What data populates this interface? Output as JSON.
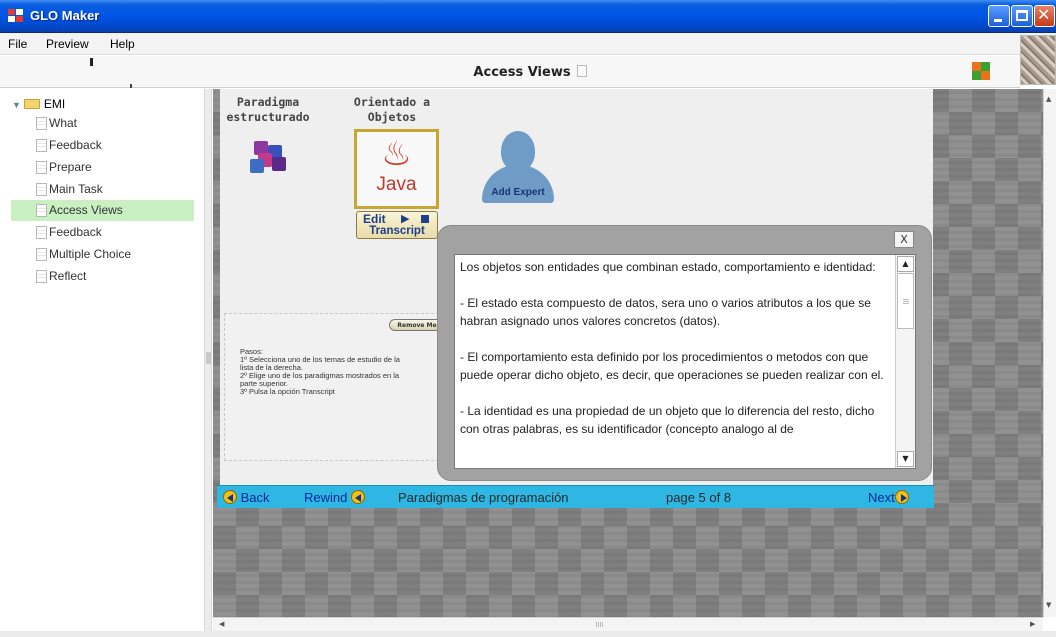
{
  "window": {
    "title": "GLO Maker"
  },
  "menu": [
    "File",
    "Preview",
    "Help"
  ],
  "page": {
    "title": "Access Views"
  },
  "tree": {
    "root": "EMI",
    "items": [
      {
        "label": "What",
        "selected": false
      },
      {
        "label": "Feedback",
        "selected": false
      },
      {
        "label": "Prepare",
        "selected": false
      },
      {
        "label": "Main Task",
        "selected": false
      },
      {
        "label": "Access Views",
        "selected": true
      },
      {
        "label": "Feedback",
        "selected": false
      },
      {
        "label": "Multiple Choice",
        "selected": false
      },
      {
        "label": "Reflect",
        "selected": false
      }
    ]
  },
  "lesson": {
    "paradigm1": [
      "Paradigma",
      "estructurado"
    ],
    "paradigm2": [
      "Orientado a",
      "Objetos"
    ],
    "java_label": "Java",
    "edit_label": "Edit",
    "transcript_label": "Transcript",
    "add_expert_label": "Add Expert",
    "remove_label": "Remove Me",
    "steps": [
      "Pasos:",
      "1º Selecciona uno de los temas de estudio de la",
      "lista de la derecha.",
      "2º Elige uno de los paradigmas mostrados en la",
      "parte superior.",
      "3º Pulsa la opción Transcript"
    ]
  },
  "transcript": {
    "close_label": "X",
    "paragraphs": [
      "Los objetos son entidades que combinan estado, comportamiento e identidad:",
      "- El estado esta compuesto de datos, sera uno o varios atributos a los que se habran asignado unos valores concretos (datos).",
      "- El comportamiento esta definido por los procedimientos o metodos con que puede operar dicho objeto, es decir, que operaciones se pueden realizar con el.",
      "- La identidad es una propiedad de un objeto que lo diferencia del resto, dicho con otras palabras, es su identificador (concepto analogo al de"
    ]
  },
  "nav": {
    "back": "Back",
    "rewind": "Rewind",
    "lesson_title": "Paradigmas de programación",
    "page": "page 5 of 8",
    "next": "Next"
  },
  "colors": {
    "titlebar": "#0055e5",
    "selected_item": "#c8f0c0",
    "navbar": "#2eb7e2",
    "nav_link": "#0b2a9c"
  },
  "icons": [
    "app-icon",
    "folder-icon",
    "page-icon",
    "java-icon",
    "expert-icon",
    "cubes-icon"
  ]
}
